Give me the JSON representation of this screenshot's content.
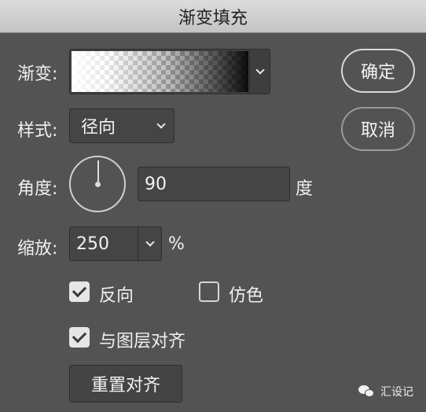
{
  "window": {
    "title": "渐变填充"
  },
  "gradient": {
    "label": "渐变:"
  },
  "style": {
    "label": "样式:",
    "value": "径向"
  },
  "angle": {
    "label": "角度:",
    "value": "90",
    "unit": "度"
  },
  "scale": {
    "label": "缩放:",
    "value": "250",
    "unit": "%"
  },
  "options": {
    "reverse": {
      "label": "反向",
      "checked": true
    },
    "dither": {
      "label": "仿色",
      "checked": false
    },
    "align": {
      "label": "与图层对齐",
      "checked": true
    }
  },
  "buttons": {
    "ok": "确定",
    "cancel": "取消",
    "reset_align": "重置对齐"
  },
  "watermark": {
    "text": "汇设记"
  },
  "icons": [
    "chevron-down-icon",
    "angle-dial-icon",
    "checkmark-icon",
    "wechat-icon"
  ]
}
